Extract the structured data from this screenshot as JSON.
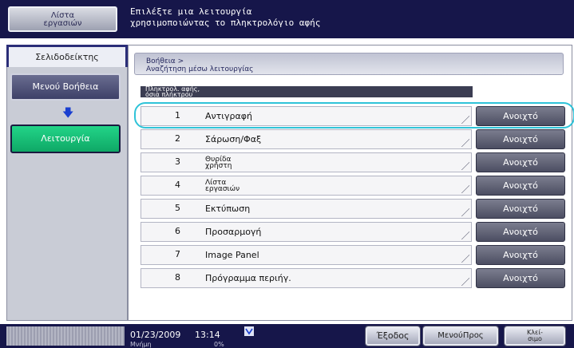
{
  "header": {
    "jobs_button": "Λίστα\nεργασιών",
    "message": "Επιλέξτε μια λειτουργία\nχρησιμοποιώντας το πληκτρολόγιο αφής"
  },
  "sidebar": {
    "title": "Σελιδοδείκτης",
    "help_menu": "Μενού Βοήθεια",
    "function": "Λειτουργία"
  },
  "main": {
    "breadcrumb": "Βοήθεια >\nΑναζήτηση μέσω λειτουργίας",
    "column_header": "Πληκτρολ. αφής,\nόσια πλήκτρου",
    "rows": [
      {
        "num": "1",
        "name": "Αντιγραφή",
        "action": "Ανοιχτό"
      },
      {
        "num": "2",
        "name": "Σάρωση/Φαξ",
        "action": "Ανοιχτό"
      },
      {
        "num": "3",
        "name": "Θυρίδα\nχρήστη",
        "action": "Ανοιχτό"
      },
      {
        "num": "4",
        "name": "Λίστα\nεργασιών",
        "action": "Ανοιχτό"
      },
      {
        "num": "5",
        "name": "Εκτύπωση",
        "action": "Ανοιχτό"
      },
      {
        "num": "6",
        "name": "Προσαρμογή",
        "action": "Ανοιχτό"
      },
      {
        "num": "7",
        "name": "Image Panel",
        "action": "Ανοιχτό"
      },
      {
        "num": "8",
        "name": "Πρόγραμμα περιήγ.",
        "action": "Ανοιχτό"
      }
    ]
  },
  "footer": {
    "date": "01/23/2009",
    "time": "13:14",
    "memory_label": "Μνήμη",
    "memory_value": "0%",
    "exit": "Έξοδος",
    "menu": "ΜενούΠρος",
    "close": "Κλεί-\nσιμο"
  },
  "colors": {
    "bar": "#16164a",
    "function_active": "#14b672",
    "highlight": "#2fc3d8"
  }
}
